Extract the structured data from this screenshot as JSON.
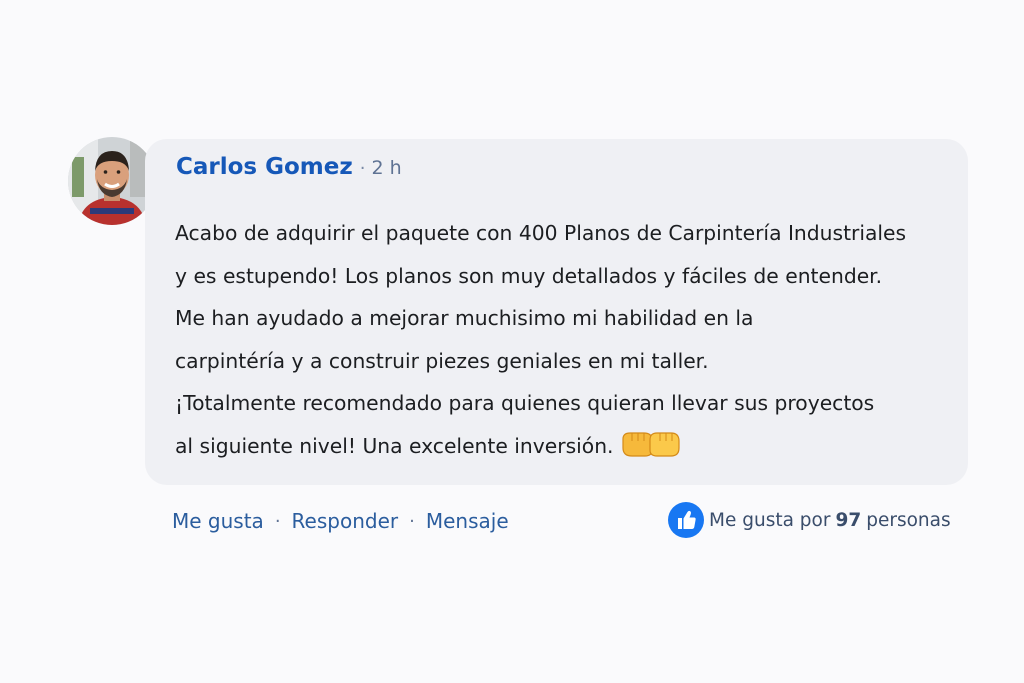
{
  "comment": {
    "author": "Carlos Gomez",
    "separator": "·",
    "time": "2 h",
    "lines": [
      "Acabo de adquirir el paquete con 400 Planos de Carpintería Industriales",
      "y es estupendo! Los planos son muy detallados y fáciles de entender.",
      "Me han ayudado a mejorar muchisimo mi habilidad en la",
      "carpintéría y a construir piezes geniales en mi taller.",
      "¡Totalmente recomendado para quienes quieran llevar sus proyectos",
      "al siguiente nivel! Una excelente inversión."
    ],
    "emoji_icon": "fist-bump-icon"
  },
  "actions": {
    "like": "Me gusta",
    "reply": "Responder",
    "message": "Mensaje",
    "separator": "·"
  },
  "likes": {
    "icon": "thumbs-up-icon",
    "prefix": "Me gusta por",
    "count": "97",
    "suffix": "personas"
  },
  "colors": {
    "author": "#1658b8",
    "link": "#2b5d9e",
    "bubble": "#eff0f4",
    "like_badge": "#1877f2"
  }
}
